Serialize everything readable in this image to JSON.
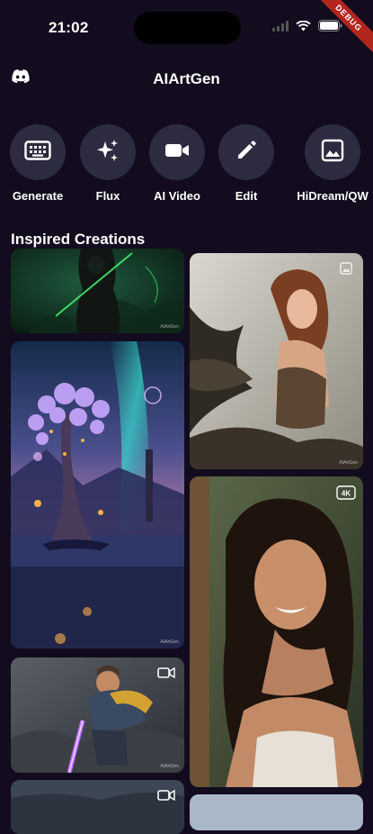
{
  "status_bar": {
    "time": "21:02",
    "debug_label": "DEBUG"
  },
  "header": {
    "title": "AIArtGen"
  },
  "tools": [
    {
      "label": "Generate",
      "icon": "keyboard-icon"
    },
    {
      "label": "Flux",
      "icon": "sparkles-icon"
    },
    {
      "label": "AI Video",
      "icon": "video-camera-icon"
    },
    {
      "label": "Edit",
      "icon": "pencil-icon"
    },
    {
      "label": "HiDream/QW",
      "icon": "image-icon"
    }
  ],
  "section": {
    "title": "Inspired Creations"
  },
  "gallery": [
    {
      "subject": "Dark hooded warrior with green glow",
      "badge": "",
      "watermark": "AIArtGen"
    },
    {
      "subject": "Fairy woman with dark wings in forest",
      "badge": "image",
      "watermark": "AIArtGen"
    },
    {
      "subject": "Glowing fantasy tree under aurora by a lake",
      "badge": "",
      "watermark": "AIArtGen"
    },
    {
      "subject": "Smiling woman with long dark hair",
      "badge": "4K",
      "watermark": ""
    },
    {
      "subject": "Bearded warrior with glowing sword",
      "badge": "video",
      "watermark": "AIArtGen"
    },
    {
      "subject": "Misty landscape",
      "badge": "video",
      "watermark": ""
    },
    {
      "subject": "Partial image",
      "badge": "",
      "watermark": ""
    }
  ]
}
